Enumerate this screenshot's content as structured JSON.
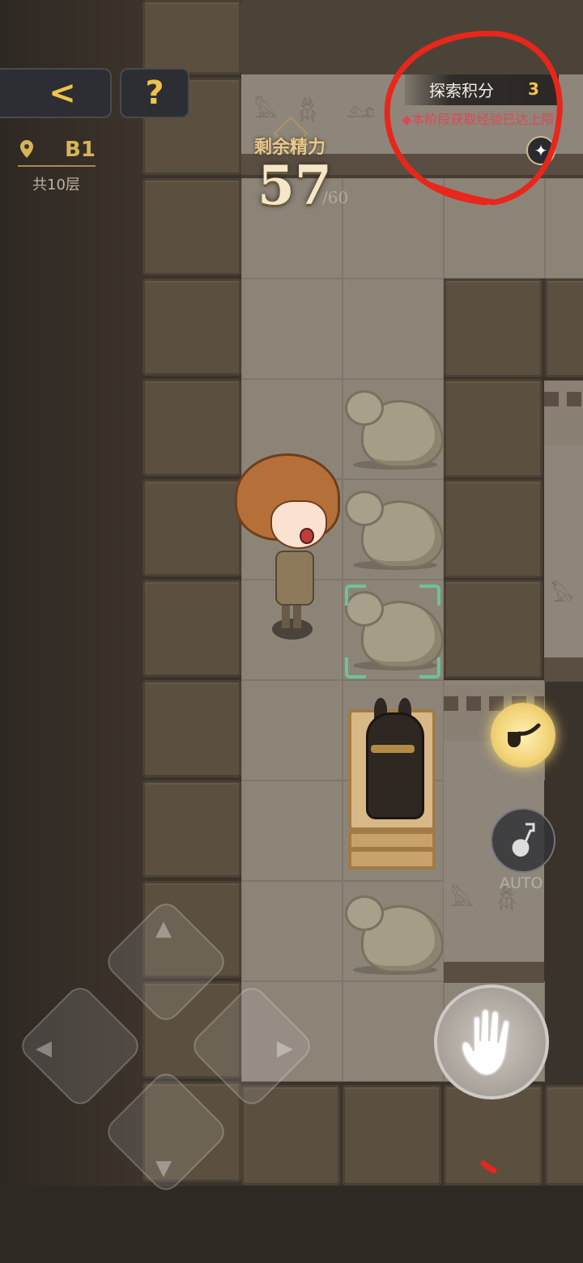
{
  "hud": {
    "back_icon": "chevron-left-icon",
    "help_icon": "question-mark-icon",
    "back_glyph": "<",
    "help_glyph": "?"
  },
  "floor": {
    "current": "B1",
    "total": "共10层"
  },
  "energy": {
    "label": "剩余精力",
    "value": "57",
    "max": "/60"
  },
  "score": {
    "label": "探索积分",
    "value": "3",
    "warning": "本阶段获取经验已达上限"
  },
  "actions": {
    "auto_label": "AUTO",
    "pipe_icon": "pipe-icon",
    "auto_icon": "shovel-icon",
    "interact_icon": "hand-icon"
  },
  "colors": {
    "accent_gold": "#f0c24c",
    "warning_red": "#d84a5a",
    "annotation_red": "#e8261b"
  }
}
